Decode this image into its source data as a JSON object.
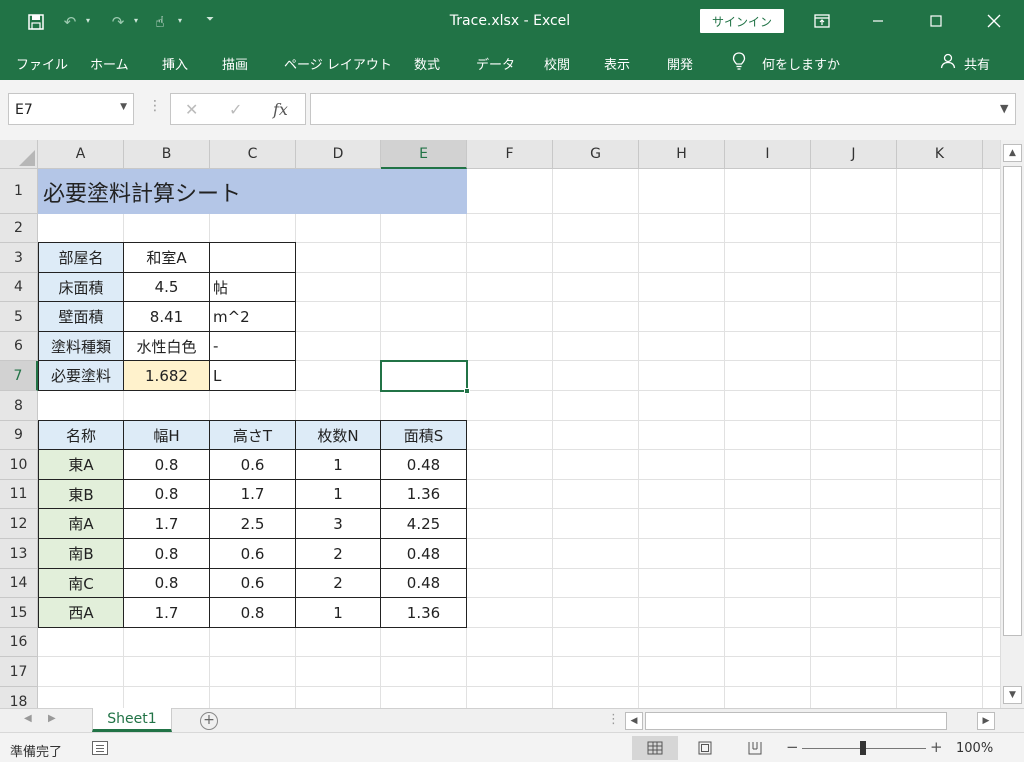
{
  "titlebar": {
    "title": "Trace.xlsx  -  Excel",
    "signin_label": "サインイン",
    "icons": [
      "save-icon",
      "undo-icon",
      "redo-icon",
      "touch-mode-icon",
      "customize-icon",
      "ribbon-display-icon",
      "minimize-icon",
      "maximize-icon",
      "close-icon"
    ]
  },
  "ribbon": {
    "tabs": [
      "ファイル",
      "ホーム",
      "挿入",
      "描画",
      "ページ レイアウト",
      "数式",
      "データ",
      "校閲",
      "表示",
      "開発"
    ],
    "tellme": "何をしますか",
    "share": "共有"
  },
  "formula_bar": {
    "namebox": "E7",
    "formula": ""
  },
  "grid": {
    "columns": [
      "A",
      "B",
      "C",
      "D",
      "E",
      "F",
      "G",
      "H",
      "I",
      "J",
      "K"
    ],
    "rows": [
      "1",
      "2",
      "3",
      "4",
      "5",
      "6",
      "7",
      "8",
      "9",
      "10",
      "11",
      "12",
      "13",
      "14",
      "15",
      "16",
      "17",
      "18"
    ],
    "selected_cell": "E7",
    "colors": {
      "title_fill": "#b4c6e7",
      "label_fill": "#ddebf7",
      "name_fill": "#e2efda",
      "result_fill": "#fff2cc",
      "accent": "#217346"
    }
  },
  "sheet": {
    "title": "必要塗料計算シート",
    "info": [
      {
        "label": "部屋名",
        "value": "和室A",
        "unit": ""
      },
      {
        "label": "床面積",
        "value": "4.5",
        "unit": "帖"
      },
      {
        "label": "壁面積",
        "value": "8.41",
        "unit": "m^2"
      },
      {
        "label": "塗料種類",
        "value": "水性白色",
        "unit": "-"
      },
      {
        "label": "必要塗料",
        "value": "1.682",
        "unit": "L"
      }
    ],
    "table_headers": [
      "名称",
      "幅H",
      "高さT",
      "枚数N",
      "面積S"
    ],
    "table_rows": [
      [
        "東A",
        "0.8",
        "0.6",
        "1",
        "0.48"
      ],
      [
        "東B",
        "0.8",
        "1.7",
        "1",
        "1.36"
      ],
      [
        "南A",
        "1.7",
        "2.5",
        "3",
        "4.25"
      ],
      [
        "南B",
        "0.8",
        "0.6",
        "2",
        "0.48"
      ],
      [
        "南C",
        "0.8",
        "0.6",
        "2",
        "0.48"
      ],
      [
        "西A",
        "1.7",
        "0.8",
        "1",
        "1.36"
      ]
    ]
  },
  "tabs": {
    "sheet1": "Sheet1"
  },
  "status": {
    "text": "準備完了",
    "zoom": "100%",
    "zoom_level": 1.0
  }
}
